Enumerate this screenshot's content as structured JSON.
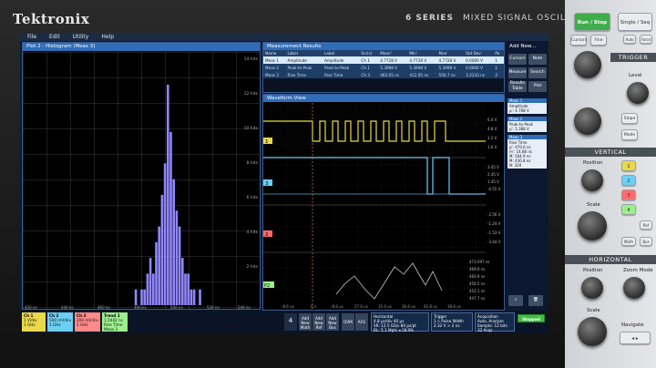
{
  "brand": "Tektronix",
  "series": {
    "model": "6 SERIES",
    "name": "MIXED SIGNAL OSCILLOSCOPE"
  },
  "menu": [
    "File",
    "Edit",
    "Utility",
    "Help"
  ],
  "histogram": {
    "title": "Plot 2 - Histogram (Meas 3)",
    "y_labels": [
      "14 hits",
      "12 hits",
      "10 hits",
      "8 hits",
      "6 hits",
      "4 hits",
      "2 hits"
    ],
    "x_labels": [
      "420 ns",
      "440 ns",
      "460 ns",
      "480 ns",
      "500 ns",
      "520 ns",
      "540 ns"
    ],
    "bar_color": "#8f86ff",
    "bins": [
      0,
      0,
      0,
      0,
      1,
      0,
      1,
      1,
      2,
      3,
      2,
      4,
      5,
      7,
      9,
      14,
      11,
      8,
      6,
      5,
      3,
      2,
      2,
      1,
      1,
      0,
      1,
      0,
      0,
      0
    ]
  },
  "measurements": {
    "title": "Measurement Results",
    "columns": [
      "Name",
      "Label",
      "Label",
      "Src(s)",
      "Mean'",
      "Min'",
      "Max'",
      "Std Dev'",
      "Po"
    ],
    "rows": [
      [
        "Meas 1",
        "Amplitude",
        "Amplitude",
        "Ch 1",
        "4.7728 V",
        "4.7728 V",
        "4.7728 V",
        "0.0000 V",
        "1"
      ],
      [
        "Meas 2",
        "Peak-to-Peak",
        "Peak-to-Peak",
        "Ch 1",
        "5.3998 V",
        "5.3998 V",
        "5.3998 V",
        "0.0000 V",
        "1"
      ],
      [
        "Meas 3",
        "Rise Time",
        "Rise Time",
        "Ch 3",
        "463.05 ns",
        "412.05 ns",
        "550.7 ns",
        "3.2233 ns",
        "2"
      ]
    ]
  },
  "waveform": {
    "title": "Waveform View",
    "right_labels": [
      "6.4 V",
      "4.8 V",
      "3.2 V",
      "1.6 V",
      "3.45 V",
      "2.45 V",
      "1.45 V",
      "-0.55 V",
      "-2.56 V",
      "-1.24 V",
      "-1.53 V",
      "-3.44 V",
      "473.097 ns",
      "469.6 ns",
      "460.9 ns",
      "456.5 ns",
      "452.1 ns",
      "447.7 ns"
    ],
    "x_labels": [
      "-8.6 us",
      "0 s",
      "-8.8 us",
      "27.6 us",
      "35.4 us",
      "30.6 us",
      "62.8 us",
      "38.8 us"
    ],
    "ch_markers": [
      "1",
      "3",
      "2",
      "P2"
    ]
  },
  "side": {
    "add_new": "Add New...",
    "buttons": [
      "Cursors",
      "Note",
      "Measure",
      "Search",
      "Results Table",
      "Plot"
    ],
    "meas": [
      {
        "title": "Meas 1",
        "lines": [
          "Amplitude",
          "μ': 4.768 V"
        ]
      },
      {
        "title": "Meas 2",
        "lines": [
          "Peak-to-Peak",
          "μ': 5.368 V"
        ]
      },
      {
        "title": "Meas 3",
        "lines": [
          "Rise Time",
          "μ': 470.6 ns",
          "m': 14.86 ns",
          "M: 504.9 ns",
          "M: 430.8 ns",
          "N: 320"
        ]
      }
    ]
  },
  "bottom": {
    "channels": [
      {
        "name": "Ch 1",
        "l1": "1 V/div",
        "l2": "1 GHz",
        "color": "#e8d84a"
      },
      {
        "name": "Ch 2",
        "l1": "500 mV/div",
        "l2": "1 GHz",
        "color": "#6bd0f2"
      },
      {
        "name": "Ch 3",
        "l1": "200 mV/div",
        "l2": "1 GHz",
        "color": "#ff6b6b"
      },
      {
        "name": "Trend 1",
        "l1": "1.5442 ns",
        "l2": "Rise Time",
        "l3": "Meas 3",
        "color": "#9cf08c"
      }
    ],
    "count": "4",
    "adds": [
      "Add New Math",
      "Add New Ref",
      "Add New Bus"
    ],
    "tools": [
      "DVM",
      "AFG"
    ],
    "horizontal": {
      "title": "Horizontal",
      "l1": "4.8 µs/div   40 µs",
      "l2": "SR: 12.5 GS/s   80 ps/pt",
      "l3": "RL: 5.1 Mpts     ◂ 18.9%"
    },
    "trigger": {
      "title": "Trigger",
      "l1": "1 ⎍ Pulse Width",
      "l2": "2.32 V   > 2 ns"
    },
    "acquisition": {
      "title": "Acquisition",
      "l1": "Auto,   Analyze",
      "l2": "Sample: 12 bits",
      "l3": "32 Acqs"
    },
    "stopped": "Stopped"
  },
  "front": {
    "run_stop": "Run / Stop",
    "single": "Single / Seq",
    "trigger_title": "TRIGGER",
    "level": "Level",
    "vertical_title": "VERTICAL",
    "position": "Position",
    "scale": "Scale",
    "horizontal_title": "HORIZONTAL",
    "zoom": "Zoom Mode",
    "navigate": "Navigate",
    "small": [
      "Cursors",
      "Fine",
      "Auto",
      "Force",
      "Slope",
      "Mode",
      "Ref",
      "Math",
      "Bus"
    ],
    "channel_buttons": [
      "1",
      "2",
      "3",
      "4"
    ]
  }
}
